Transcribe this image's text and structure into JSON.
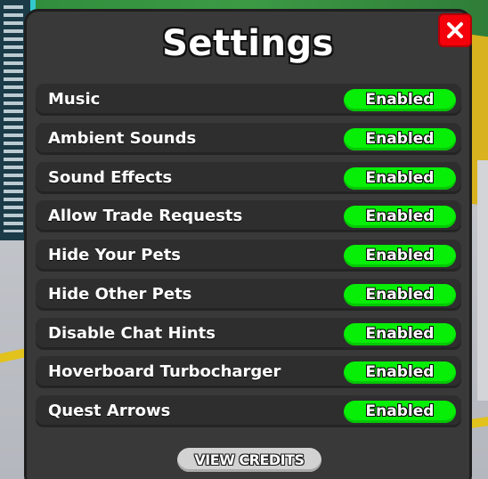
{
  "panel": {
    "title": "Settings",
    "close_icon": "close-x-icon",
    "close_color": "#f4000a",
    "background_color": "#393939"
  },
  "settings": [
    {
      "label": "Music",
      "status": "Enabled"
    },
    {
      "label": "Ambient Sounds",
      "status": "Enabled"
    },
    {
      "label": "Sound Effects",
      "status": "Enabled"
    },
    {
      "label": "Allow Trade Requests",
      "status": "Enabled"
    },
    {
      "label": "Hide Your Pets",
      "status": "Enabled"
    },
    {
      "label": "Hide Other Pets",
      "status": "Enabled"
    },
    {
      "label": "Disable Chat Hints",
      "status": "Enabled"
    },
    {
      "label": "Hoverboard Turbocharger",
      "status": "Enabled"
    },
    {
      "label": "Quest Arrows",
      "status": "Enabled"
    }
  ],
  "toggle_color": "#07ee07",
  "footer": {
    "credits_label": "VIEW CREDITS"
  }
}
